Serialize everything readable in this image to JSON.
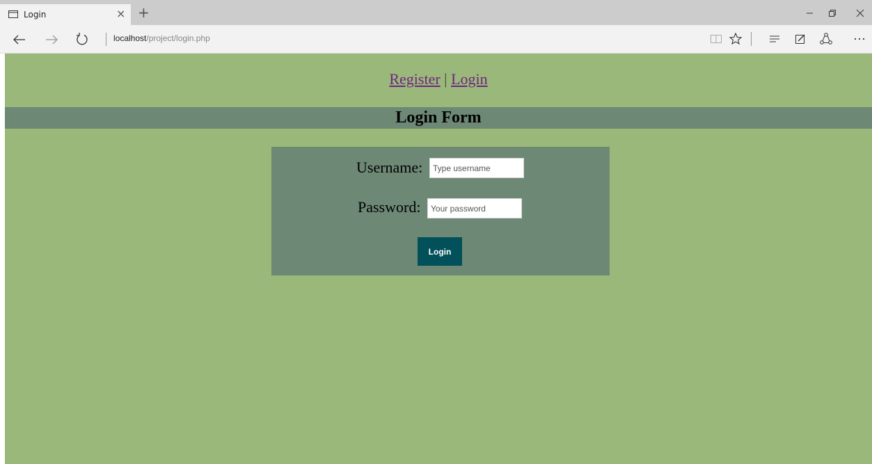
{
  "browser": {
    "tab_title": "Login",
    "tab_close": "×",
    "new_tab": "+",
    "address_host": "localhost",
    "address_path": "/project/login.php"
  },
  "nav": {
    "register_label": "Register",
    "separator": "|",
    "login_label": "Login"
  },
  "form": {
    "title": "Login Form",
    "username_label": "Username:",
    "username_placeholder": "Type username",
    "password_label": "Password:",
    "password_placeholder": "Your password",
    "submit_label": "Login"
  },
  "colors": {
    "page_bg": "#9ab879",
    "panel_bg": "#6d8875",
    "button_bg": "#01505a",
    "link": "#6f2384"
  }
}
